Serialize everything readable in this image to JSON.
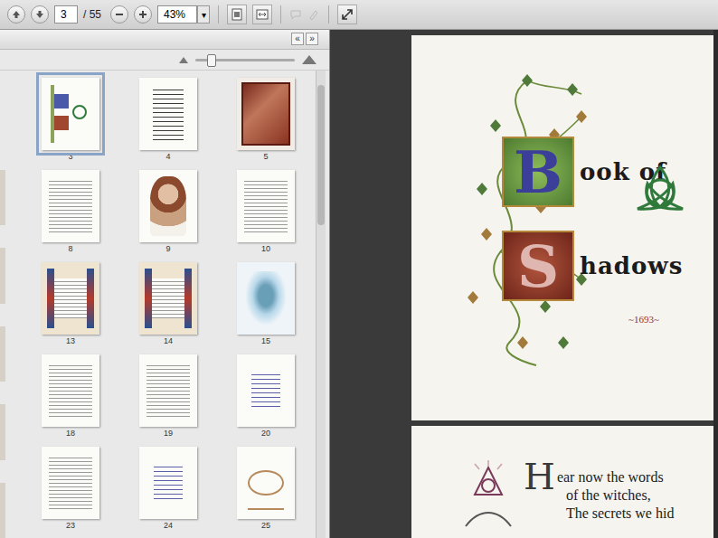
{
  "toolbar": {
    "page": "3",
    "page_count": "/ 55",
    "zoom": "43%",
    "zoom_menu": "▾"
  },
  "thumbnail_panel": {
    "nav_buttons": [
      "«",
      "»"
    ],
    "size_level": 0.15,
    "scroll_position": 0.03,
    "thumbnails": [
      {
        "label": "3",
        "kind": "title",
        "selected": true
      },
      {
        "label": "4",
        "kind": "text-art",
        "selected": false
      },
      {
        "label": "5",
        "kind": "picture",
        "selected": false
      },
      {
        "label": "8",
        "kind": "text",
        "selected": false
      },
      {
        "label": "9",
        "kind": "portrait",
        "selected": false
      },
      {
        "label": "10",
        "kind": "text",
        "selected": false
      },
      {
        "label": "13",
        "kind": "bordered",
        "selected": false
      },
      {
        "label": "14",
        "kind": "bordered",
        "selected": false
      },
      {
        "label": "15",
        "kind": "figure",
        "selected": false
      },
      {
        "label": "18",
        "kind": "text",
        "selected": false
      },
      {
        "label": "19",
        "kind": "text",
        "selected": false
      },
      {
        "label": "20",
        "kind": "text-blue",
        "selected": false
      },
      {
        "label": "23",
        "kind": "text",
        "selected": false
      },
      {
        "label": "24",
        "kind": "text-blue",
        "selected": false
      },
      {
        "label": "25",
        "kind": "sketch",
        "selected": false
      }
    ]
  },
  "document": {
    "title_page": {
      "lines": [
        {
          "initial": "B",
          "text": "ook of"
        },
        {
          "initial": "S",
          "text": "hadows"
        }
      ],
      "date": "~1693~"
    },
    "next_page": {
      "initial": "H",
      "lines": [
        "ear now the words",
        "of the witches,",
        "The secrets we hid"
      ]
    }
  }
}
